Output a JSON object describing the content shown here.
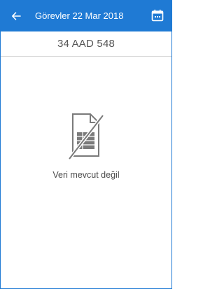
{
  "header": {
    "back_icon": "arrow-left-icon",
    "title": "Görevler 22 Mar 2018",
    "calendar_icon": "calendar-icon"
  },
  "subheader": {
    "plate": "34 AAD 548"
  },
  "empty_state": {
    "icon": "no-document-icon",
    "message": "Veri mevcut değil"
  },
  "colors": {
    "header_bg": "#1f7ad4",
    "icon_gray": "#7a7a7a"
  }
}
